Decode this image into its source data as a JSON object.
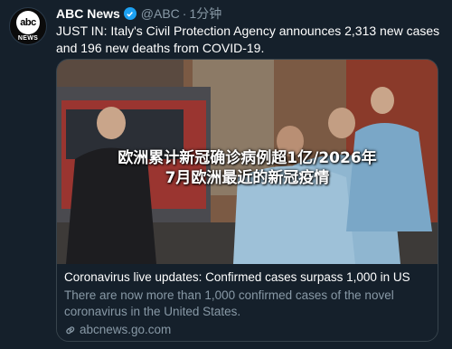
{
  "account": {
    "avatar_top": "abc",
    "avatar_bottom": "NEWS",
    "name": "ABC News",
    "handle": "@ABC",
    "separator": "·",
    "time": "1分钟"
  },
  "tweet": {
    "text": "JUST IN: Italy's Civil Protection Agency announces 2,313 new cases and 196 new deaths from COVID-19."
  },
  "overlay": {
    "line1": "欧洲累计新冠确诊病例超1亿/2026年",
    "line2": "7月欧洲最近的新冠疫情"
  },
  "card": {
    "title": "Coronavirus live updates: Confirmed cases surpass 1,000 in US",
    "description": "There are now more than 1,000 confirmed cases of the novel coronavirus in the United States.",
    "link": "abcnews.go.com"
  },
  "colors": {
    "background": "#15202b",
    "secondary_text": "#8899a6",
    "verified_blue": "#1da1f2",
    "border": "#38444d"
  }
}
